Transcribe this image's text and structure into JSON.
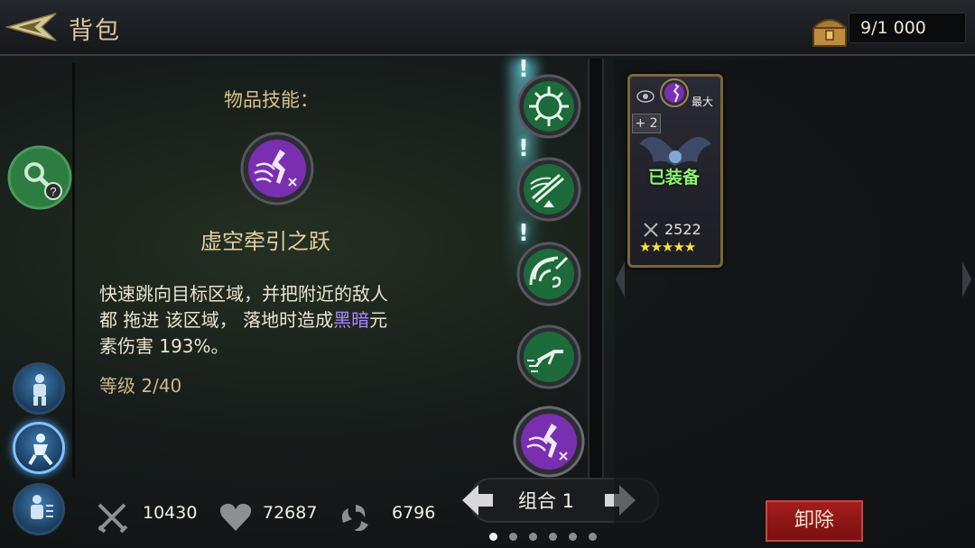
{
  "header": {
    "title": "背包",
    "capacity": "9/1 000",
    "back_icon": "back-arrow-icon",
    "chest_icon": "treasure-chest-icon"
  },
  "skill": {
    "section_title": "物品技能：",
    "name": "虚空牵引之跃",
    "description_1": "快速跳向目标区域，并把附近的敌人",
    "description_2": "都 拖进 该区域， 落地时造成",
    "description_dark": "黑暗",
    "description_3": "元",
    "description_4": "素伤害 ",
    "damage_value": "193%。",
    "level": "等级 2/40"
  },
  "stats": {
    "attack": "10430",
    "health": "72687",
    "special": "6796"
  },
  "combo": {
    "label": "组合 1",
    "page_count": 6,
    "active_page": 0
  },
  "item_card": {
    "top_right": "最大",
    "plus": "+ 2",
    "status": "已装备",
    "power": "2522",
    "stars": "★★★★★"
  },
  "buttons": {
    "unload": "卸除"
  },
  "colors": {
    "purple_skill": "#7a2fb0",
    "green_skill": "#1d6a3a",
    "dark_element": "#a987ff",
    "equipped": "#8cf76f",
    "unload": "#a41d1d"
  }
}
